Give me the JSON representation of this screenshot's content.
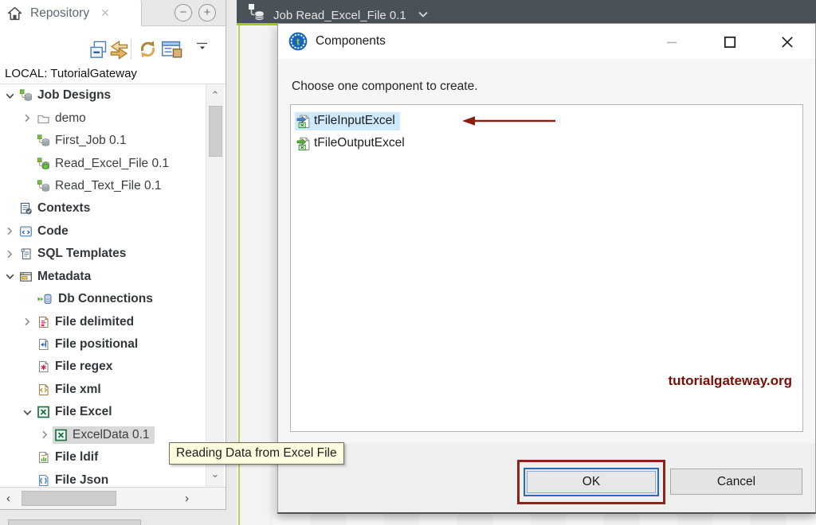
{
  "repo": {
    "tab": "Repository",
    "local": "LOCAL: TutorialGateway",
    "tree": [
      {
        "label": "Job Designs",
        "icon": "job-designs-icon",
        "expanded": true
      },
      {
        "label": "demo",
        "icon": "folder-icon",
        "collapsed": true
      },
      {
        "label": "First_Job 0.1",
        "icon": "job-icon"
      },
      {
        "label": "Read_Excel_File 0.1",
        "icon": "job-locked-icon"
      },
      {
        "label": "Read_Text_File 0.1",
        "icon": "job-icon"
      },
      {
        "label": "Contexts",
        "icon": "contexts-icon"
      },
      {
        "label": "Code",
        "icon": "code-icon",
        "collapsed": true
      },
      {
        "label": "SQL Templates",
        "icon": "sql-templates-icon",
        "collapsed": true
      },
      {
        "label": "Metadata",
        "icon": "metadata-icon",
        "expanded": true
      },
      {
        "label": "Db Connections",
        "icon": "db-connections-icon"
      },
      {
        "label": "File delimited",
        "icon": "file-delimited-icon",
        "collapsed": true
      },
      {
        "label": "File positional",
        "icon": "file-positional-icon"
      },
      {
        "label": "File regex",
        "icon": "file-regex-icon"
      },
      {
        "label": "File xml",
        "icon": "file-xml-icon"
      },
      {
        "label": "File Excel",
        "icon": "file-excel-icon",
        "expanded": true
      },
      {
        "label": "ExcelData 0.1",
        "icon": "excel-data-icon",
        "collapsed": true,
        "selected": true
      },
      {
        "label": "File ldif",
        "icon": "file-ldif-icon"
      },
      {
        "label": "File Json",
        "icon": "file-json-icon"
      }
    ]
  },
  "editor": {
    "tab_title": "Job Read_Excel_File 0.1"
  },
  "dialog": {
    "title": "Components",
    "prompt": "Choose one component to create.",
    "items": [
      {
        "label": "tFileInputExcel",
        "icon": "tfileinputexcel-icon",
        "selected": true
      },
      {
        "label": "tFileOutputExcel",
        "icon": "tfileoutputexcel-icon"
      }
    ],
    "watermark": "tutorialgateway.org",
    "ok": "OK",
    "cancel": "Cancel"
  },
  "tooltip": {
    "text": "Reading Data from Excel File"
  },
  "colors": {
    "accent_lime": "#a6c829",
    "topbar_dark": "#4a5157",
    "selection_blue": "#cfe9ff",
    "selection_gray": "#d9d9d9",
    "annotation_red": "#8a241b",
    "watermark_red": "#7d0d04",
    "tooltip_bg": "#fffee1"
  }
}
